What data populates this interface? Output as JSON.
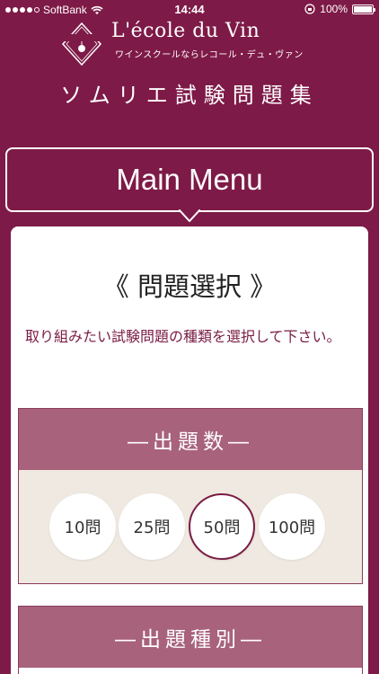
{
  "status_bar": {
    "carrier": "SoftBank",
    "time": "14:44",
    "battery_percent": "100%"
  },
  "logo": {
    "name": "L'école du Vin",
    "subtitle": "ワインスクールならレコール・デュ・ヴァン",
    "emblem_text": "L'école du Vin"
  },
  "app_title": "ソムリエ試験問題集",
  "main_menu": {
    "label": "Main Menu"
  },
  "card": {
    "section_title": "《 問題選択 》",
    "instruction": "取り組みたい試験問題の種類を選択して下さい。"
  },
  "question_count": {
    "header": "―出題数―",
    "options": [
      {
        "label": "10問",
        "selected": false
      },
      {
        "label": "25問",
        "selected": false
      },
      {
        "label": "50問",
        "selected": true
      },
      {
        "label": "100問",
        "selected": false
      }
    ]
  },
  "question_type": {
    "header": "―出題種別―"
  },
  "colors": {
    "brand": "#7e1a47",
    "panel_header": "#a8627c",
    "panel_body": "#efe9e1",
    "accent_text": "#7a1c44"
  }
}
